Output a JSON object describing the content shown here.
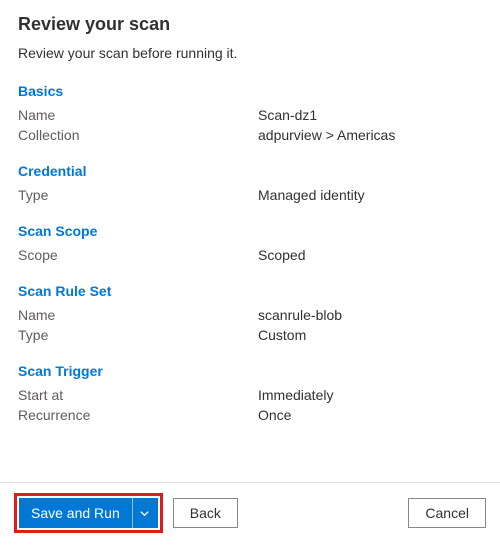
{
  "colors": {
    "link": "#0078d4",
    "primary": "#0078d4",
    "highlight_box": "#e3191c"
  },
  "header": {
    "title": "Review your scan",
    "subtitle": "Review your scan before running it."
  },
  "sections": {
    "basics": {
      "heading": "Basics",
      "name_label": "Name",
      "name_value": "Scan-dz1",
      "collection_label": "Collection",
      "collection_value": "adpurview > Americas"
    },
    "credential": {
      "heading": "Credential",
      "type_label": "Type",
      "type_value": "Managed identity"
    },
    "scope": {
      "heading": "Scan Scope",
      "scope_label": "Scope",
      "scope_value": "Scoped"
    },
    "ruleset": {
      "heading": "Scan Rule Set",
      "name_label": "Name",
      "name_value": "scanrule-blob",
      "type_label": "Type",
      "type_value": "Custom"
    },
    "trigger": {
      "heading": "Scan Trigger",
      "start_label": "Start at",
      "start_value": "Immediately",
      "recur_label": "Recurrence",
      "recur_value": "Once"
    }
  },
  "footer": {
    "save_and_run": "Save and Run",
    "back": "Back",
    "cancel": "Cancel"
  }
}
